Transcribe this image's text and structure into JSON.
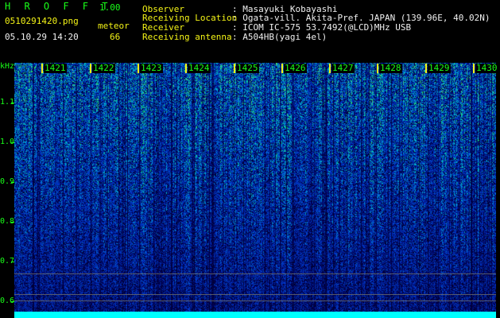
{
  "header": {
    "app_title": "H R O F F T",
    "version": "1.00",
    "filename": "0510291420.png",
    "datetime": "05.10.29 14:20",
    "mode_label": "meteor",
    "count": "66",
    "fields": [
      {
        "label": "Observer",
        "value": ": Masayuki Kobayashi"
      },
      {
        "label": "Receiving Location",
        "value": ": Ogata-vill. Akita-Pref. JAPAN (139.96E, 40.02N)"
      },
      {
        "label": "Receiver",
        "value": ": ICOM IC-575 53.7492(@LCD)MHz USB"
      },
      {
        "label": "Receiving antenna",
        "value": ": A504HB(yagi 4el)"
      }
    ]
  },
  "axis": {
    "unit": "kHz",
    "freq_labels": [
      "1.1",
      "1.0",
      "0.9",
      "0.8",
      "0.7",
      "0.6"
    ],
    "time_labels": [
      "1421",
      "1422",
      "1423",
      "1424",
      "1425",
      "1426",
      "1427",
      "1428",
      "1429",
      "1430"
    ]
  },
  "colors": {
    "background": "#000000",
    "header_green": "#19ff19",
    "header_yellow": "#f4f416",
    "baseline_cyan": "#00ffff",
    "spectrum_low": "#0a1aa8",
    "spectrum_high": "#19ff19"
  }
}
